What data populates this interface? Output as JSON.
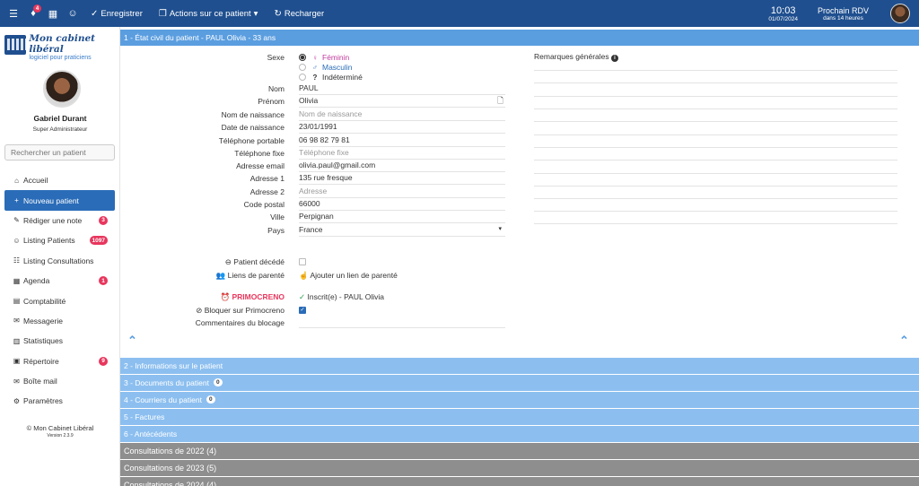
{
  "topbar": {
    "icons": [
      {
        "name": "menu-icon",
        "glyph": "☰"
      },
      {
        "name": "bell-icon",
        "glyph": "🔔",
        "badge": "4"
      },
      {
        "name": "calendar-icon",
        "glyph": "▦"
      },
      {
        "name": "users-icon",
        "glyph": "👥"
      }
    ],
    "save_label": "Enregistrer",
    "actions_label": "Actions sur ce patient",
    "reload_label": "Recharger",
    "time": "10:03",
    "date": "01/07/2024",
    "next_rdv_title": "Prochain RDV",
    "next_rdv_sub": "dans 14 heures"
  },
  "sidebar": {
    "logo_title": "Mon cabinet libéral",
    "logo_subtitle": "logiciel pour praticiens",
    "user_name": "Gabriel Durant",
    "user_role": "Super Administrateur",
    "search_placeholder": "Rechercher un patient",
    "items": [
      {
        "label": "Accueil",
        "icon": "home-icon",
        "glyph": "⌂",
        "count": ""
      },
      {
        "label": "Nouveau patient",
        "icon": "plus-icon",
        "glyph": "+",
        "count": "",
        "active": true
      },
      {
        "label": "Rédiger une note",
        "icon": "pencil-icon",
        "glyph": "✎",
        "count": "3"
      },
      {
        "label": "Listing Patients",
        "icon": "users-icon",
        "glyph": "👤",
        "count": "1097"
      },
      {
        "label": "Listing Consultations",
        "icon": "list-icon",
        "glyph": "☷",
        "count": ""
      },
      {
        "label": "Agenda",
        "icon": "calendar-icon",
        "glyph": "▦",
        "count": "1"
      },
      {
        "label": "Comptabilité",
        "icon": "calculator-icon",
        "glyph": "▤",
        "count": ""
      },
      {
        "label": "Messagerie",
        "icon": "chat-icon",
        "glyph": "✉",
        "count": ""
      },
      {
        "label": "Statistiques",
        "icon": "chart-icon",
        "glyph": "▥",
        "count": ""
      },
      {
        "label": "Répertoire",
        "icon": "address-book-icon",
        "glyph": "▣",
        "count": "9"
      },
      {
        "label": "Boîte mail",
        "icon": "inbox-icon",
        "glyph": "✉",
        "count": ""
      },
      {
        "label": "Paramètres",
        "icon": "gear-icon",
        "glyph": "⚙",
        "count": ""
      }
    ],
    "footer_title": "© Mon Cabinet Libéral",
    "footer_version": "Version 2.3.9"
  },
  "section1": {
    "title": "1 - État civil du patient - PAUL Olivia - 33 ans",
    "sexe_label": "Sexe",
    "sexe_options": [
      {
        "label": "Féminin",
        "color": "#c0399c",
        "glyph": "♀",
        "selected": true
      },
      {
        "label": "Masculin",
        "color": "#2a6cb8",
        "glyph": "♂",
        "selected": false
      },
      {
        "label": "Indéterminé",
        "color": "#333333",
        "glyph": "?",
        "selected": false
      }
    ],
    "fields": [
      {
        "label": "Nom",
        "value": "PAUL",
        "placeholder": false
      },
      {
        "label": "Prénom",
        "value": "Olivia",
        "placeholder": false
      },
      {
        "label": "Nom de naissance",
        "value": "Nom de naissance",
        "placeholder": true
      },
      {
        "label": "Date de naissance",
        "value": "23/01/1991",
        "placeholder": false
      },
      {
        "label": "Téléphone portable",
        "value": "06 98 82 79 81",
        "placeholder": false
      },
      {
        "label": "Téléphone fixe",
        "value": "Téléphone fixe",
        "placeholder": true
      },
      {
        "label": "Adresse email",
        "value": "olivia.paul@gmail.com",
        "placeholder": false
      },
      {
        "label": "Adresse 1",
        "value": "135 rue fresque",
        "placeholder": false
      },
      {
        "label": "Adresse 2",
        "value": "Adresse",
        "placeholder": true
      },
      {
        "label": "Code postal",
        "value": "66000",
        "placeholder": false
      },
      {
        "label": "Ville",
        "value": "Perpignan",
        "placeholder": false
      },
      {
        "label": "Pays",
        "value": "France",
        "placeholder": false
      }
    ],
    "remarks_title": "Remarques générales",
    "deceased_label": "Patient décédé",
    "relations_label": "Liens de parenté",
    "add_relation_label": "Ajouter un lien de parenté",
    "primocreno_label": "PRIMOCRENO",
    "primocreno_status": "Inscrit(e) - PAUL Olivia",
    "block_label": "Bloquer sur Primocreno",
    "block_comment_label": "Commentaires du blocage"
  },
  "accordions": [
    {
      "label": "2 - Informations sur le patient",
      "count": "",
      "style": "blue"
    },
    {
      "label": "3 - Documents du patient",
      "count": "0",
      "style": "blue"
    },
    {
      "label": "4 - Courriers du patient",
      "count": "0",
      "style": "blue"
    },
    {
      "label": "5 - Factures",
      "count": "",
      "style": "blue"
    },
    {
      "label": "6 - Antécédents",
      "count": "",
      "style": "blue"
    },
    {
      "label": "Consultations de 2022 (4)",
      "count": "",
      "style": "gray"
    },
    {
      "label": "Consultations de 2023 (5)",
      "count": "",
      "style": "gray"
    },
    {
      "label": "Consultations de 2024 (4)",
      "count": "",
      "style": "gray"
    }
  ],
  "colors": {
    "topbar": "#1f4f8f",
    "accent": "#2a6cb8",
    "section_header": "#5b9ee0",
    "accordion_blue": "#8cbff0",
    "accordion_gray": "#8e8e8e",
    "badge": "#e8365d",
    "primocreno": "#e8365d"
  }
}
